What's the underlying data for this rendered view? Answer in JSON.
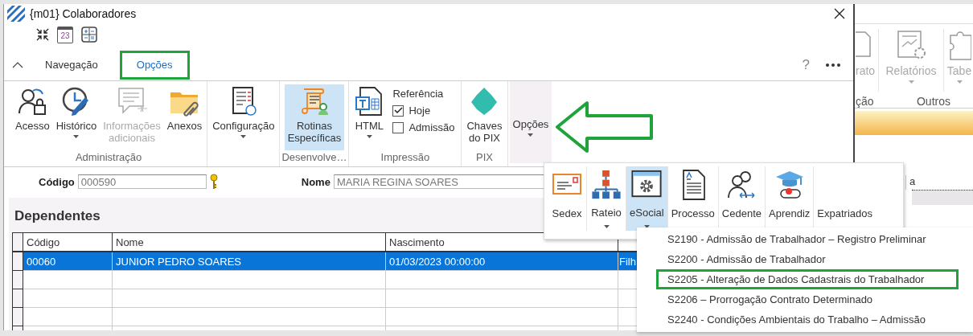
{
  "window": {
    "title": "{m01} Colaboradores",
    "calendar_day": "23"
  },
  "ribbon": {
    "tabs": [
      {
        "label": "Navegação",
        "selected": false,
        "marked": false
      },
      {
        "label": "Opções",
        "selected": true,
        "marked": true
      }
    ],
    "help": "?",
    "groups": [
      {
        "label": "Administração",
        "items": [
          {
            "kind": "button",
            "label": "Acesso",
            "caret": false,
            "disabled": false,
            "selected": false,
            "hover": false
          },
          {
            "kind": "button",
            "label": "Histórico",
            "caret": true,
            "disabled": false,
            "selected": false,
            "hover": false
          },
          {
            "kind": "button",
            "label": "Informações\nadicionais",
            "caret": false,
            "disabled": true,
            "selected": false,
            "hover": false
          },
          {
            "kind": "button",
            "label": "Anexos",
            "caret": false,
            "disabled": false,
            "selected": false,
            "hover": false
          }
        ]
      },
      {
        "items": [
          {
            "kind": "button",
            "label": "Configuração",
            "caret": true,
            "disabled": false,
            "selected": false,
            "hover": false
          }
        ]
      },
      {
        "label": "Desenvolve…",
        "items": [
          {
            "kind": "button",
            "label": "Rotinas\nEspecíficas",
            "caret": false,
            "disabled": false,
            "selected": true,
            "hover": false
          }
        ]
      },
      {
        "label": "Impressão",
        "items": [
          {
            "kind": "button",
            "label": "HTML",
            "caret": true,
            "disabled": false,
            "selected": false,
            "hover": false
          },
          {
            "kind": "checks",
            "title": "Referência",
            "options": [
              {
                "label": "Hoje",
                "checked": true
              },
              {
                "label": "Admissão",
                "checked": false
              }
            ]
          }
        ]
      },
      {
        "label": "PIX",
        "items": [
          {
            "kind": "button",
            "label": "Chaves\ndo PIX",
            "caret": false,
            "disabled": false,
            "selected": false,
            "hover": false
          }
        ]
      },
      {
        "items": [
          {
            "kind": "button",
            "label": "Opções",
            "caret": true,
            "disabled": false,
            "selected": false,
            "hover": true
          }
        ]
      }
    ]
  },
  "arrow_annotation": true,
  "form": {
    "code": {
      "label": "Código",
      "value": "000590"
    },
    "name": {
      "label": "Nome",
      "value": "MARIA REGINA SOARES"
    }
  },
  "dependents": {
    "title": "Dependentes",
    "columns": [
      "Código",
      "Nome",
      "Nascimento"
    ],
    "rows": [
      {
        "cells": [
          "00060",
          "JUNIOR PEDRO SOARES",
          "01/03/2023 00:00:00",
          "Filh"
        ],
        "selected": true
      }
    ]
  },
  "options_menu": {
    "items": [
      {
        "label": "Sedex",
        "caret": false,
        "selected": false
      },
      {
        "label": "Rateio",
        "caret": true,
        "selected": false
      },
      {
        "label": "eSocial",
        "caret": true,
        "selected": true
      },
      {
        "label": "Processo",
        "caret": false,
        "selected": false
      },
      {
        "label": "Cedente",
        "caret": false,
        "selected": false
      },
      {
        "label": "Aprendiz",
        "caret": false,
        "selected": false
      },
      {
        "label": "Expatriados",
        "caret": false,
        "selected": false
      }
    ]
  },
  "esocial_menu": {
    "items": [
      {
        "label": "S2190 - Admissão de Trabalhador – Registro Preliminar",
        "marked": false
      },
      {
        "label": "S2200 - Admissão de Trabalhador",
        "marked": false
      },
      {
        "label": "S2205 - Alteração de Dados Cadastrais do Trabalhador",
        "marked": true
      },
      {
        "label": "S2206 – Prorrogação Contrato Determinado",
        "marked": false
      },
      {
        "label": "S2240 - Condições Ambientais do Trabalho – Admissão",
        "marked": false
      }
    ]
  },
  "background_window": {
    "buttons": [
      {
        "label": "rato"
      },
      {
        "label": "Relatórios"
      },
      {
        "label": "Tabe"
      }
    ],
    "groups": [
      "ção",
      "Outros"
    ],
    "field_value": "a"
  }
}
